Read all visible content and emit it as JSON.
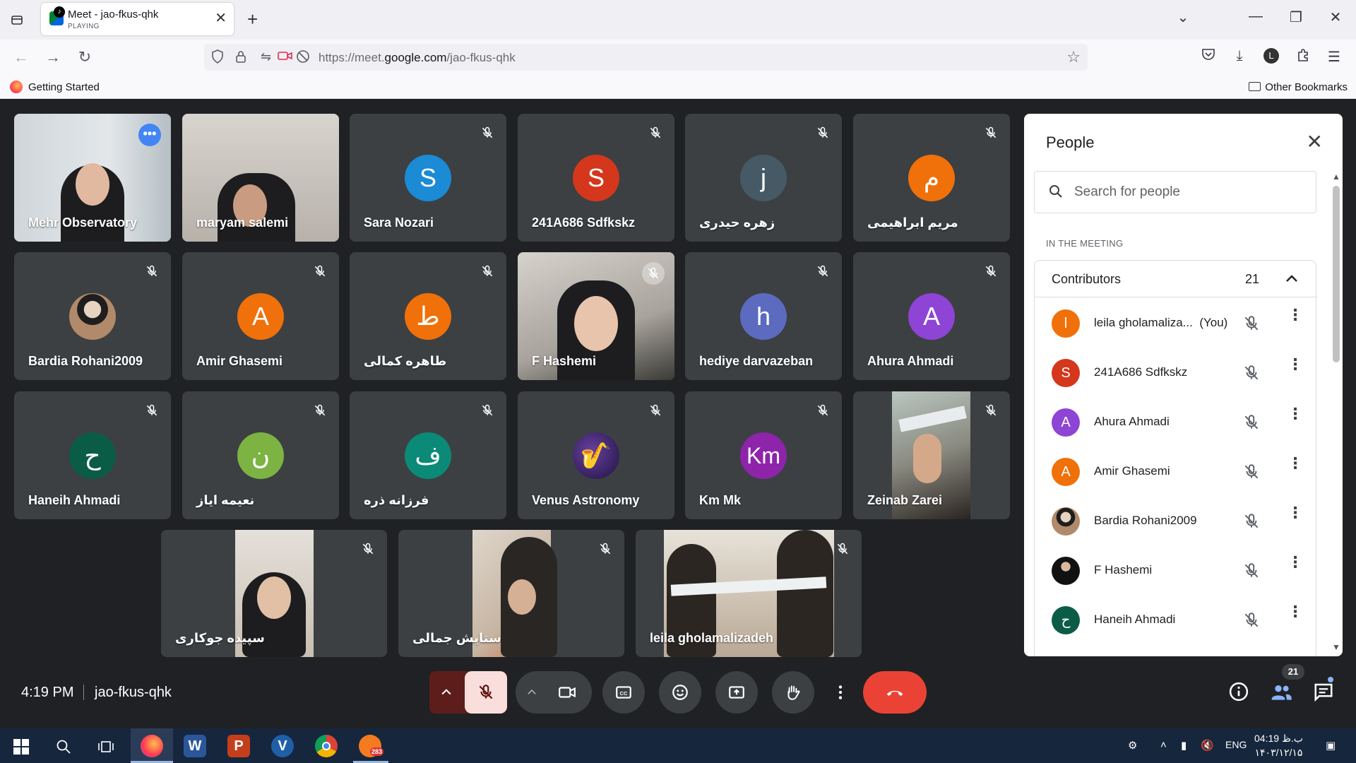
{
  "browser": {
    "tab": {
      "title": "Meet - jao-fkus-qhk",
      "status": "PLAYING"
    },
    "url": {
      "prefix": "https://meet.",
      "domain": "google.com",
      "path": "/jao-fkus-qhk"
    },
    "bookmarks": {
      "getting_started": "Getting Started",
      "other": "Other Bookmarks"
    }
  },
  "tiles": [
    {
      "name": "Mehr Observatory",
      "type": "video"
    },
    {
      "name": "maryam salemi",
      "type": "video"
    },
    {
      "name": "Sara Nozari",
      "initial": "S",
      "color": "#1a8bd4"
    },
    {
      "name": "241A686 Sdfkskz",
      "initial": "S",
      "color": "#d4371c"
    },
    {
      "name": "زهره حیدری",
      "initial": "j",
      "color": "#455a64"
    },
    {
      "name": "مریم ابراهیمی",
      "initial": "م",
      "color": "#f07009"
    },
    {
      "name": "Bardia Rohani2009",
      "type": "photo"
    },
    {
      "name": "Amir Ghasemi",
      "initial": "A",
      "color": "#f07009"
    },
    {
      "name": "طاهره کمالی",
      "initial": "ط",
      "color": "#f07009"
    },
    {
      "name": "F Hashemi",
      "type": "video"
    },
    {
      "name": "hediye darvazeban",
      "initial": "h",
      "color": "#5c6bc0"
    },
    {
      "name": "Ahura Ahmadi",
      "initial": "A",
      "color": "#8e44d4"
    },
    {
      "name": "Haneih Ahmadi",
      "initial": "ح",
      "color": "#0b5c47"
    },
    {
      "name": "نعیمه ایاز",
      "initial": "ن",
      "color": "#7cb342"
    },
    {
      "name": "فرزانه ذره",
      "initial": "ف",
      "color": "#0b8a78"
    },
    {
      "name": "Venus Astronomy",
      "type": "photo"
    },
    {
      "name": "Km Mk",
      "initial": "Km",
      "color": "#8e24aa"
    },
    {
      "name": "Zeinab Zarei",
      "type": "video"
    },
    {
      "name": "سپیده جوکاری",
      "type": "video"
    },
    {
      "name": "ستایش جمالی",
      "type": "video"
    },
    {
      "name": "leila gholamalizadeh",
      "type": "video"
    }
  ],
  "people_panel": {
    "title": "People",
    "search_placeholder": "Search for people",
    "section": "IN THE MEETING",
    "group": {
      "title": "Contributors",
      "count": "21"
    },
    "people": [
      {
        "name": "leila gholamaliza...",
        "suffix": "(You)",
        "initial": "l",
        "color": "#f07009"
      },
      {
        "name": "241A686 Sdfkskz",
        "initial": "S",
        "color": "#d4371c"
      },
      {
        "name": "Ahura Ahmadi",
        "initial": "A",
        "color": "#8e44d4"
      },
      {
        "name": "Amir Ghasemi",
        "initial": "A",
        "color": "#f07009"
      },
      {
        "name": "Bardia Rohani2009",
        "initial": "",
        "color": "#8a7a6a"
      },
      {
        "name": "F Hashemi",
        "initial": "",
        "color": "#2a3a2a"
      },
      {
        "name": "Haneih Ahmadi",
        "initial": "ح",
        "color": "#0b5c47"
      }
    ]
  },
  "controls": {
    "time": "4:19 PM",
    "meeting_code": "jao-fkus-qhk",
    "people_badge": "21"
  },
  "taskbar": {
    "language": "ENG",
    "time": "04:19 ب.ظ",
    "date": "۱۴۰۳/۱۲/۱۵",
    "notification_count": "283"
  }
}
